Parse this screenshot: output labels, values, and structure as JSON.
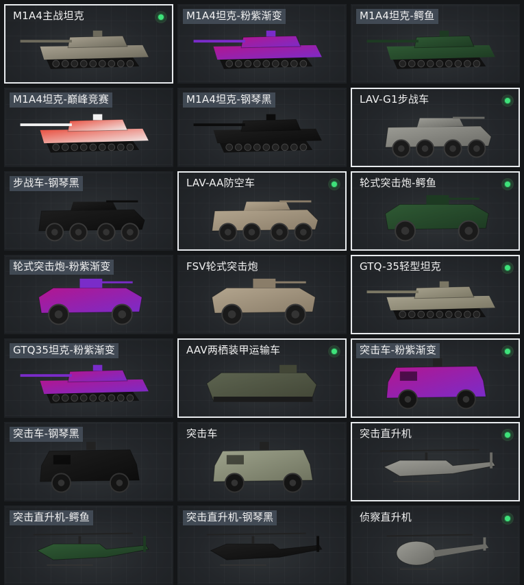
{
  "vehicles": [
    {
      "name": "M1A4主战坦克",
      "kind": "tank",
      "skin": "camo",
      "selected": true,
      "owned": true,
      "tagged": false
    },
    {
      "name": "M1A4坦克-粉紫渐变",
      "kind": "tank",
      "skin": "pink",
      "selected": false,
      "owned": false,
      "tagged": true
    },
    {
      "name": "M1A4坦克-鳄鱼",
      "kind": "tank",
      "skin": "croc",
      "selected": false,
      "owned": false,
      "tagged": true
    },
    {
      "name": "M1A4坦克-巅峰竞赛",
      "kind": "tank",
      "skin": "race",
      "selected": false,
      "owned": false,
      "tagged": true
    },
    {
      "name": "M1A4坦克-钢琴黑",
      "kind": "tank",
      "skin": "black",
      "selected": false,
      "owned": false,
      "tagged": true
    },
    {
      "name": "LAV-G1步战车",
      "kind": "ifv",
      "skin": "grey",
      "selected": true,
      "owned": true,
      "tagged": false
    },
    {
      "name": "步战车-钢琴黑",
      "kind": "ifv",
      "skin": "black",
      "selected": false,
      "owned": false,
      "tagged": true
    },
    {
      "name": "LAV-AA防空车",
      "kind": "ifv",
      "skin": "sand",
      "selected": true,
      "owned": true,
      "tagged": false
    },
    {
      "name": "轮式突击炮-鳄鱼",
      "kind": "wheeled",
      "skin": "croc",
      "selected": true,
      "owned": true,
      "tagged": false
    },
    {
      "name": "轮式突击炮-粉紫渐变",
      "kind": "wheeled",
      "skin": "pink",
      "selected": false,
      "owned": false,
      "tagged": true
    },
    {
      "name": "FSV轮式突击炮",
      "kind": "wheeled",
      "skin": "sand",
      "selected": false,
      "owned": false,
      "tagged": false
    },
    {
      "name": "GTQ-35轻型坦克",
      "kind": "tank",
      "skin": "khaki",
      "selected": true,
      "owned": true,
      "tagged": false
    },
    {
      "name": "GTQ35坦克-粉紫渐变",
      "kind": "tank",
      "skin": "pink",
      "selected": false,
      "owned": false,
      "tagged": true
    },
    {
      "name": "AAV两栖装甲运输车",
      "kind": "aav",
      "skin": "green",
      "selected": true,
      "owned": true,
      "tagged": false
    },
    {
      "name": "突击车-粉紫渐变",
      "kind": "truck",
      "skin": "pink",
      "selected": true,
      "owned": true,
      "tagged": true
    },
    {
      "name": "突击车-钢琴黑",
      "kind": "truck",
      "skin": "black",
      "selected": false,
      "owned": false,
      "tagged": true
    },
    {
      "name": "突击车",
      "kind": "truck",
      "skin": "olive",
      "selected": false,
      "owned": false,
      "tagged": false
    },
    {
      "name": "突击直升机",
      "kind": "heli",
      "skin": "grey",
      "selected": true,
      "owned": true,
      "tagged": false
    },
    {
      "name": "突击直升机-鳄鱼",
      "kind": "heli",
      "skin": "croc",
      "selected": false,
      "owned": false,
      "tagged": true
    },
    {
      "name": "突击直升机-钢琴黑",
      "kind": "heli",
      "skin": "black",
      "selected": false,
      "owned": false,
      "tagged": true
    },
    {
      "name": "侦察直升机",
      "kind": "scout",
      "skin": "grey",
      "selected": false,
      "owned": true,
      "tagged": false
    }
  ],
  "colors": {
    "selected_border": "#e9ecef",
    "owned_dot": "#3ee27a",
    "tag_bg": "#46505c",
    "skin_camo": [
      "#a9a291",
      "#6d6a5c"
    ],
    "skin_pink": [
      "#b2168f",
      "#7a2cc9"
    ],
    "skin_croc": [
      "#2f5a34",
      "#1d3a22"
    ],
    "skin_race": [
      "#e84a3a",
      "#f2f2f2"
    ],
    "skin_black": [
      "#1e1e1e",
      "#0c0c0c"
    ],
    "skin_grey": [
      "#9c9c95",
      "#6b6b66"
    ],
    "skin_sand": [
      "#b3a58e",
      "#8a7d69"
    ],
    "skin_khaki": [
      "#a7a28e",
      "#7b7764"
    ],
    "skin_green": [
      "#5d6450",
      "#424636"
    ],
    "skin_olive": [
      "#9ea38c",
      "#6f735f"
    ]
  }
}
